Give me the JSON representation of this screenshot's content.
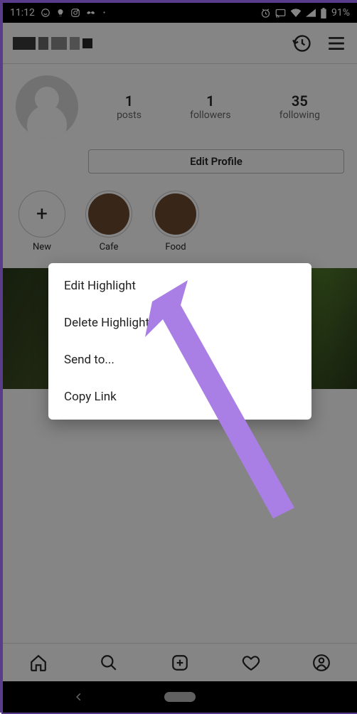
{
  "status_bar": {
    "time": "11:12",
    "battery_text": "91%"
  },
  "profile": {
    "stats": {
      "posts": {
        "num": "1",
        "label": "posts"
      },
      "followers": {
        "num": "1",
        "label": "followers"
      },
      "following": {
        "num": "35",
        "label": "following"
      }
    },
    "edit_button": "Edit Profile"
  },
  "highlights": [
    {
      "label": "New"
    },
    {
      "label": "Cafe"
    },
    {
      "label": "Food"
    }
  ],
  "popup": {
    "edit": "Edit Highlight",
    "delete": "Delete Highlight",
    "send": "Send to...",
    "copy": "Copy Link"
  }
}
